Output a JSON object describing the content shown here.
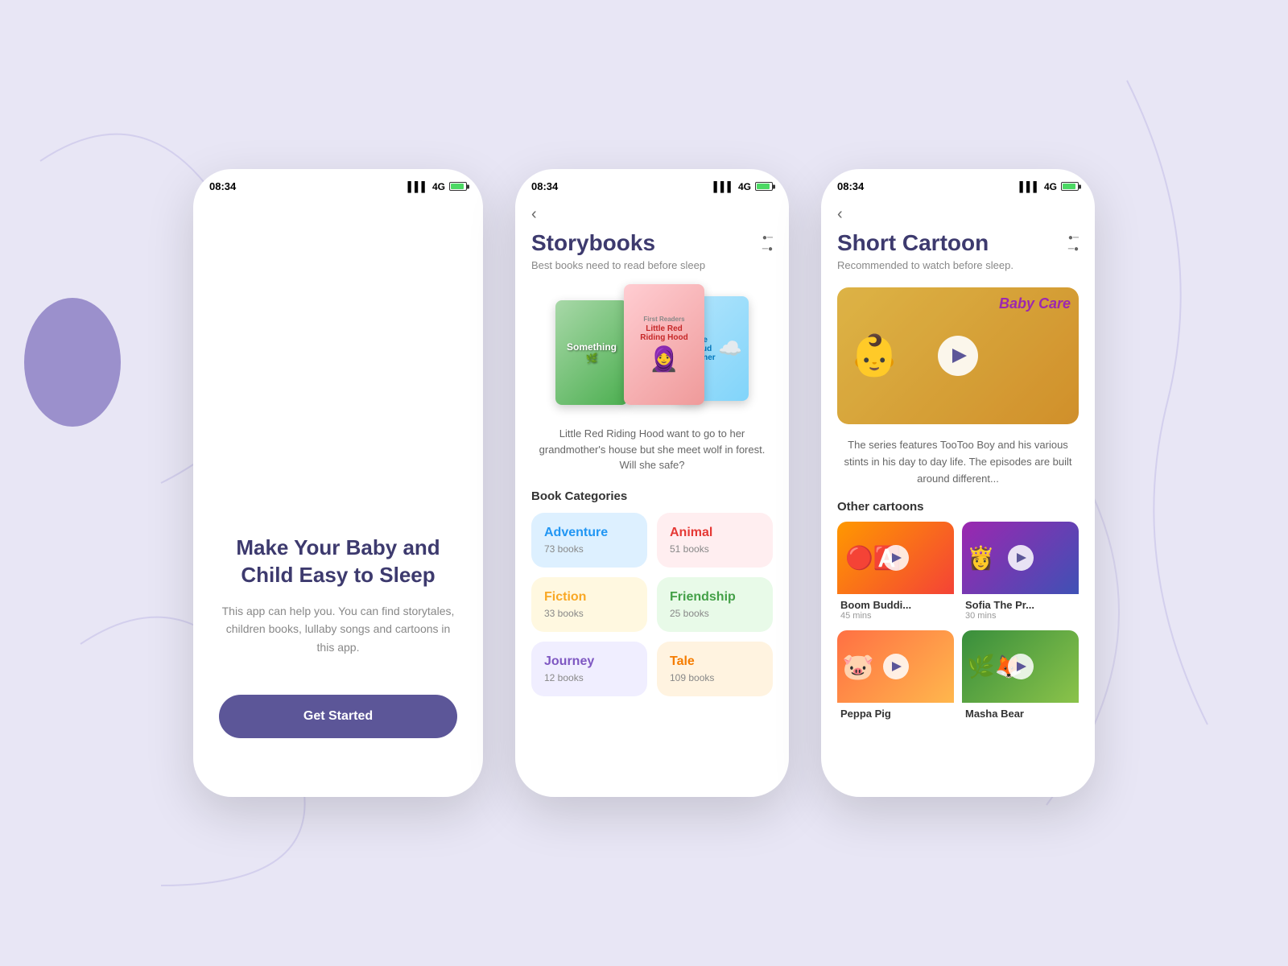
{
  "background": {
    "color": "#e8e6f5"
  },
  "phone1": {
    "status": {
      "time": "08:34",
      "signal": "4G"
    },
    "title": "Make Your Baby and Child Easy to Sleep",
    "description": "This app can help you. You can find storytales, children books, lullaby songs and cartoons in this app.",
    "button_label": "Get Started"
  },
  "phone2": {
    "status": {
      "time": "08:34",
      "signal": "4G"
    },
    "title": "Storybooks",
    "subtitle": "Best books need to read before sleep",
    "books": [
      {
        "title": "Something",
        "color": "cover-something"
      },
      {
        "title": "Little Red Riding Hood",
        "color": "cover-lrrh"
      },
      {
        "title": "The Cloud Spinner",
        "color": "cover-cloud"
      }
    ],
    "book_description": "Little Red Riding Hood want to go to her grandmother's house but she meet wolf in forest. Will she safe?",
    "categories_title": "Book Categories",
    "categories": [
      {
        "name": "Adventure",
        "count": "73 books",
        "color": "blue",
        "bg": "blue"
      },
      {
        "name": "Animal",
        "count": "51 books",
        "color": "pink",
        "bg": "pink"
      },
      {
        "name": "Fiction",
        "count": "33 books",
        "color": "yellow",
        "bg": "yellow"
      },
      {
        "name": "Friendship",
        "count": "25 books",
        "color": "green",
        "bg": "green"
      },
      {
        "name": "Journey",
        "count": "12 books",
        "color": "purple",
        "bg": "purple"
      },
      {
        "name": "Tale",
        "count": "109 books",
        "color": "peach",
        "bg": "peach"
      }
    ]
  },
  "phone3": {
    "status": {
      "time": "08:34",
      "signal": "4G"
    },
    "title": "Short Cartoon",
    "subtitle": "Recommended to watch before sleep.",
    "main_video": {
      "label": "Baby Care",
      "description": "The series features TooToo Boy and his various stints in his day to day life. The episodes are built around different..."
    },
    "other_cartoons_title": "Other cartoons",
    "cartoons": [
      {
        "title": "Boom Buddi...",
        "duration": "45 mins",
        "color": "thumb-img-1"
      },
      {
        "title": "Sofia The Pr...",
        "duration": "30 mins",
        "color": "thumb-img-2"
      },
      {
        "title": "Peppa Pig",
        "duration": "",
        "color": "thumb-img-3"
      },
      {
        "title": "Masha Bear",
        "duration": "",
        "color": "thumb-img-4"
      }
    ]
  }
}
